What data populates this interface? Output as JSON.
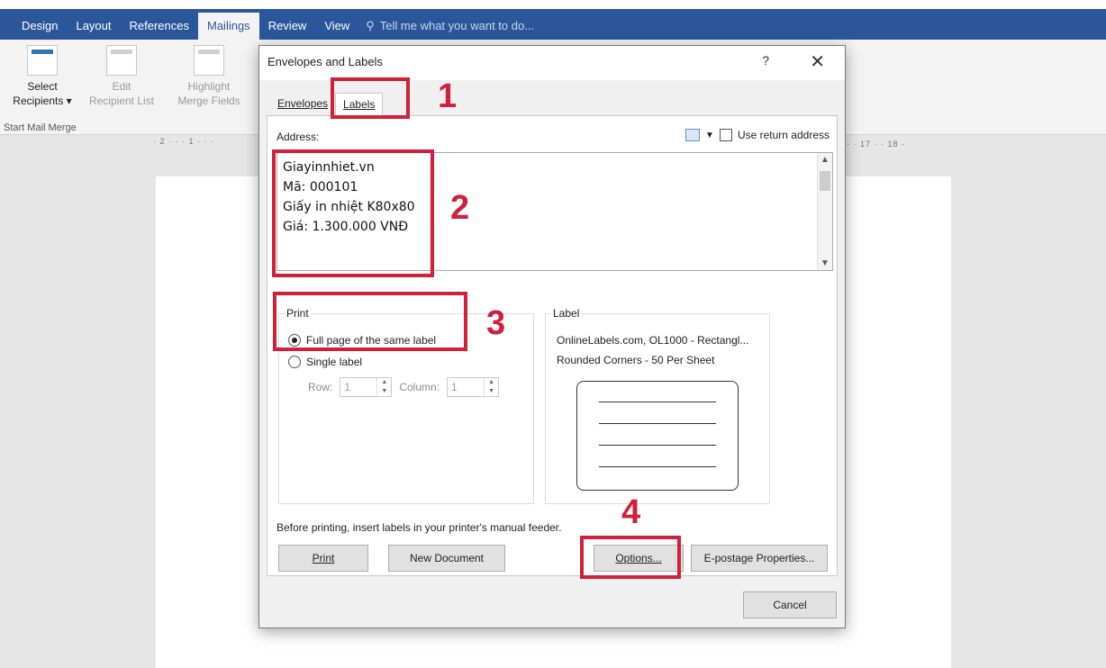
{
  "ribbon": {
    "tabs": [
      "Design",
      "Layout",
      "References",
      "Mailings",
      "Review",
      "View"
    ],
    "active_tab": "Mailings",
    "tell_me": "Tell me what you want to do...",
    "buttons": [
      {
        "line1": "Select",
        "line2": "Recipients ▾"
      },
      {
        "line1": "Edit",
        "line2": "Recipient List"
      },
      {
        "line1": "Highlight",
        "line2": "Merge Fields"
      }
    ],
    "group_label": "Start Mail Merge",
    "ruler_left": "· 2 · · · 1 · · ·",
    "ruler_right": "· · 17 · · 18 ·"
  },
  "dialog": {
    "title": "Envelopes and Labels",
    "help": "?",
    "close": "✕",
    "tabs": [
      "Envelopes",
      "Labels"
    ],
    "address_label": "Address:",
    "use_return_address": "Use return address",
    "address_lines": [
      "Giayinnhiet.vn",
      "Mã: 000101",
      "Giấy in nhiệt K80x80",
      "Giá: 1.300.000 VNĐ"
    ],
    "print_group": "Print",
    "full_page": "Full page of the same label",
    "single_label": "Single label",
    "row_label": "Row:",
    "row_value": "1",
    "column_label": "Column:",
    "column_value": "1",
    "label_group": "Label",
    "label_line1": "OnlineLabels.com, OL1000 - Rectangl...",
    "label_line2": "Rounded Corners - 50 Per Sheet",
    "note": "Before printing, insert labels in your printer's manual feeder.",
    "buttons": {
      "print": "Print",
      "new_document": "New Document",
      "options": "Options...",
      "epostage": "E-postage Properties...",
      "cancel": "Cancel"
    }
  },
  "annotations": [
    "1",
    "2",
    "3",
    "4"
  ],
  "colors": {
    "ribbon": "#2b579a",
    "annotation": "#d0203a"
  }
}
